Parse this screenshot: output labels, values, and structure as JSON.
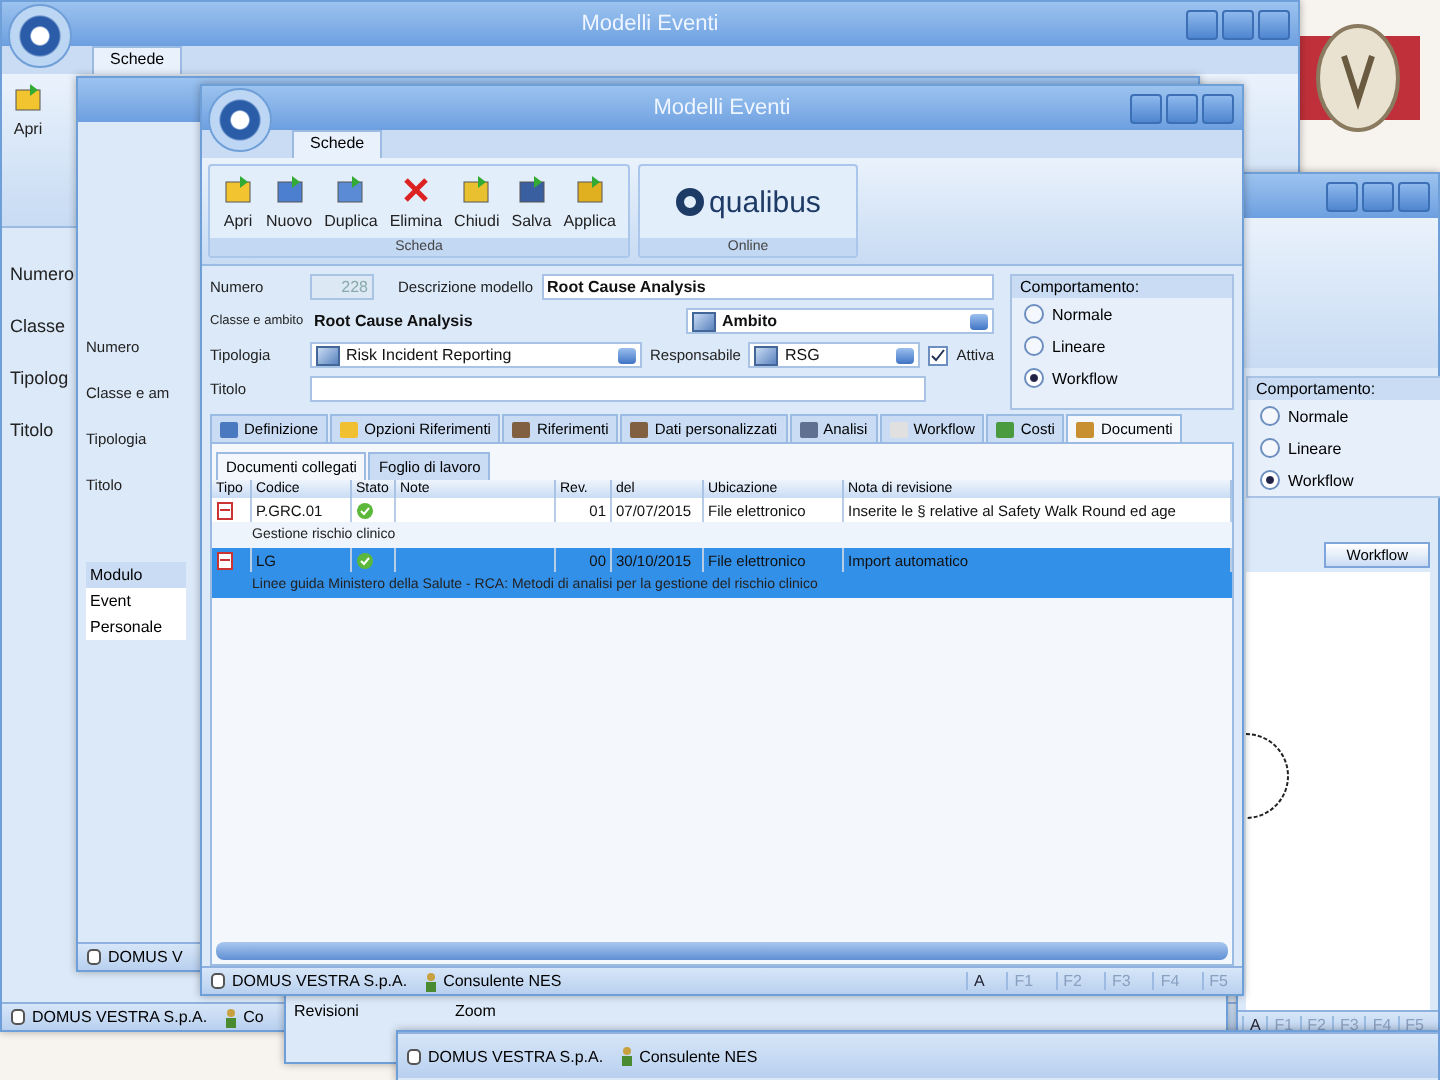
{
  "back_left": {
    "title": "Modelli Eventi",
    "tab": "Schede",
    "button": "Apri",
    "labels": [
      "Numero",
      "Classe",
      "Tipolog",
      "Titolo"
    ],
    "status": [
      "DOMUS VESTRA S.p.A.",
      "Co"
    ]
  },
  "back_mid": {
    "labels": [
      "Numero",
      "Classe e am",
      "Tipologia",
      "Titolo"
    ],
    "list_header": "Modulo",
    "list": [
      "Event",
      "Personale"
    ],
    "status": "DOMUS V"
  },
  "back_right": {
    "group_title": "Comportamento:",
    "options": [
      {
        "label": "Normale",
        "selected": false
      },
      {
        "label": "Lineare",
        "selected": false
      },
      {
        "label": "Workflow",
        "selected": true
      }
    ],
    "button": "Workflow",
    "keys": [
      "A",
      "F1",
      "F2",
      "F3",
      "F4",
      "F5"
    ]
  },
  "back_bottom": {
    "tab": "Revisioni",
    "side_label": "Zoom",
    "status": [
      "DOMUS VESTRA S.p.A.",
      "Consulente NES"
    ]
  },
  "window": {
    "title": "Modelli Eventi",
    "tab": "Schede",
    "ribbon": [
      {
        "label": "Apri",
        "kind": "open"
      },
      {
        "label": "Nuovo",
        "kind": "new"
      },
      {
        "label": "Duplica",
        "kind": "copy"
      },
      {
        "label": "Elimina",
        "kind": "delete"
      },
      {
        "label": "Chiudi",
        "kind": "close"
      },
      {
        "label": "Salva",
        "kind": "save"
      },
      {
        "label": "Applica",
        "kind": "apply"
      }
    ],
    "ribbon_group": "Scheda",
    "logo_text": "qualibus",
    "logo_group": "Online",
    "form": {
      "numero_label": "Numero",
      "numero": "228",
      "descrizione_label": "Descrizione modello",
      "descrizione": "Root Cause Analysis",
      "classe_label": "Classe e ambito",
      "classe": "Root Cause Analysis",
      "ambito": "Ambito",
      "tipologia_label": "Tipologia",
      "tipologia": "Risk Incident Reporting",
      "responsabile_label": "Responsabile",
      "responsabile": "RSG",
      "attiva_label": "Attiva",
      "attiva": true,
      "titolo_label": "Titolo"
    },
    "comportamento": {
      "title": "Comportamento:",
      "options": [
        {
          "label": "Normale",
          "selected": false
        },
        {
          "label": "Lineare",
          "selected": false
        },
        {
          "label": "Workflow",
          "selected": true
        }
      ]
    },
    "tabs": [
      {
        "label": "Definizione",
        "selected": false
      },
      {
        "label": "Opzioni Riferimenti",
        "selected": false
      },
      {
        "label": "Riferimenti",
        "selected": false
      },
      {
        "label": "Dati personalizzati",
        "selected": false
      },
      {
        "label": "Analisi",
        "selected": false
      },
      {
        "label": "Workflow",
        "selected": false
      },
      {
        "label": "Costi",
        "selected": false
      },
      {
        "label": "Documenti",
        "selected": true
      }
    ],
    "subtabs": [
      {
        "label": "Documenti collegati",
        "selected": true
      },
      {
        "label": "Foglio di lavoro",
        "selected": false
      }
    ],
    "table": {
      "columns": [
        "Tipo",
        "Codice",
        "Stato",
        "Note",
        "Rev.",
        "del",
        "Ubicazione",
        "Nota di revisione"
      ],
      "rows": [
        {
          "codice": "P.GRC.01",
          "rev": "01",
          "del": "07/07/2015",
          "ubicazione": "File elettronico",
          "nota": "Inserite le § relative al Safety Walk Round ed age",
          "description": "Gestione rischio clinico",
          "selected": false
        },
        {
          "codice": "LG",
          "rev": "00",
          "del": "30/10/2015",
          "ubicazione": "File elettronico",
          "nota": "Import automatico",
          "description": "Linee guida Ministero della Salute - RCA: Metodi di analisi per la gestione del rischio clinico",
          "selected": true
        }
      ]
    },
    "status": [
      "DOMUS VESTRA S.p.A.",
      "Consulente NES"
    ],
    "keys": [
      "A",
      "F1",
      "F2",
      "F3",
      "F4",
      "F5"
    ]
  }
}
